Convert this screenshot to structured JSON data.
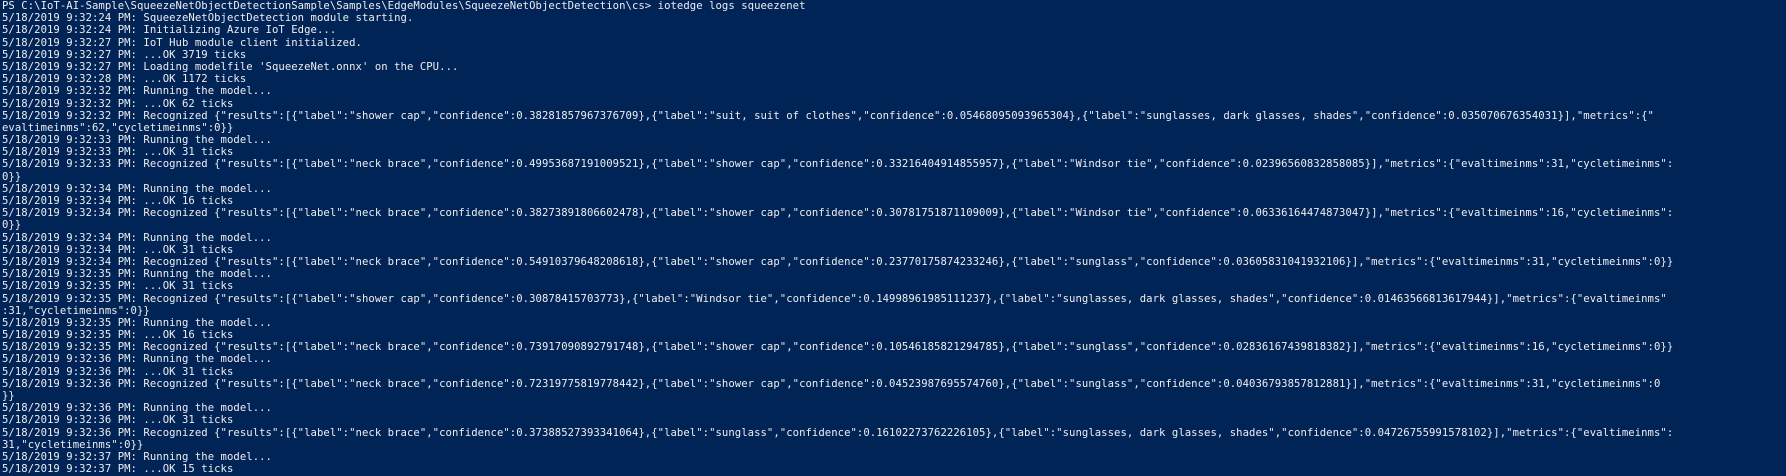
{
  "terminal": {
    "background": "#012456",
    "foreground": "#eeedf0",
    "lines": [
      "PS C:\\IoT-AI-Sample\\SqueezeNetObjectDetectionSample\\Samples\\EdgeModules\\SqueezeNetObjectDetection\\cs> iotedge logs squeezenet",
      "5/18/2019 9:32:24 PM: SqueezeNetObjectDetection module starting.",
      "5/18/2019 9:32:24 PM: Initializing Azure IoT Edge...",
      "5/18/2019 9:32:27 PM: IoT Hub module client initialized.",
      "5/18/2019 9:32:27 PM: ...OK 3719 ticks",
      "5/18/2019 9:32:27 PM: Loading modelfile 'SqueezeNet.onnx' on the CPU...",
      "5/18/2019 9:32:28 PM: ...OK 1172 ticks",
      "5/18/2019 9:32:32 PM: Running the model...",
      "5/18/2019 9:32:32 PM: ...OK 62 ticks",
      "5/18/2019 9:32:32 PM: Recognized {\"results\":[{\"label\":\"shower cap\",\"confidence\":0.38281857967376709},{\"label\":\"suit, suit of clothes\",\"confidence\":0.05468095093965304},{\"label\":\"sunglasses, dark glasses, shades\",\"confidence\":0.035070676354031}],\"metrics\":{\"",
      "evaltimeinms\":62,\"cycletimeinms\":0}}",
      "5/18/2019 9:32:33 PM: Running the model...",
      "5/18/2019 9:32:33 PM: ...OK 31 ticks",
      "5/18/2019 9:32:33 PM: Recognized {\"results\":[{\"label\":\"neck brace\",\"confidence\":0.49953687191009521},{\"label\":\"shower cap\",\"confidence\":0.33216404914855957},{\"label\":\"Windsor tie\",\"confidence\":0.02396560832858085}],\"metrics\":{\"evaltimeinms\":31,\"cycletimeinms\":",
      "0}}",
      "5/18/2019 9:32:34 PM: Running the model...",
      "5/18/2019 9:32:34 PM: ...OK 16 ticks",
      "5/18/2019 9:32:34 PM: Recognized {\"results\":[{\"label\":\"neck brace\",\"confidence\":0.38273891806602478},{\"label\":\"shower cap\",\"confidence\":0.30781751871109009},{\"label\":\"Windsor tie\",\"confidence\":0.06336164474873047}],\"metrics\":{\"evaltimeinms\":16,\"cycletimeinms\":",
      "0}}",
      "5/18/2019 9:32:34 PM: Running the model...",
      "5/18/2019 9:32:34 PM: ...OK 31 ticks",
      "5/18/2019 9:32:34 PM: Recognized {\"results\":[{\"label\":\"neck brace\",\"confidence\":0.54910379648208618},{\"label\":\"shower cap\",\"confidence\":0.23770175874233246},{\"label\":\"sunglass\",\"confidence\":0.03605831041932106}],\"metrics\":{\"evaltimeinms\":31,\"cycletimeinms\":0}}",
      "5/18/2019 9:32:35 PM: Running the model...",
      "5/18/2019 9:32:35 PM: ...OK 31 ticks",
      "5/18/2019 9:32:35 PM: Recognized {\"results\":[{\"label\":\"shower cap\",\"confidence\":0.30878415703773},{\"label\":\"Windsor tie\",\"confidence\":0.14998961985111237},{\"label\":\"sunglasses, dark glasses, shades\",\"confidence\":0.01463566813617944}],\"metrics\":{\"evaltimeinms\"",
      ":31,\"cycletimeinms\":0}}",
      "5/18/2019 9:32:35 PM: Running the model...",
      "5/18/2019 9:32:35 PM: ...OK 16 ticks",
      "5/18/2019 9:32:35 PM: Recognized {\"results\":[{\"label\":\"neck brace\",\"confidence\":0.73917090892791748},{\"label\":\"shower cap\",\"confidence\":0.10546185821294785},{\"label\":\"sunglass\",\"confidence\":0.02836167439818382}],\"metrics\":{\"evaltimeinms\":16,\"cycletimeinms\":0}}",
      "5/18/2019 9:32:36 PM: Running the model...",
      "5/18/2019 9:32:36 PM: ...OK 31 ticks",
      "5/18/2019 9:32:36 PM: Recognized {\"results\":[{\"label\":\"neck brace\",\"confidence\":0.72319775819778442},{\"label\":\"shower cap\",\"confidence\":0.04523987695574760},{\"label\":\"sunglass\",\"confidence\":0.04036793857812881}],\"metrics\":{\"evaltimeinms\":31,\"cycletimeinms\":0",
      "}}",
      "5/18/2019 9:32:36 PM: Running the model...",
      "5/18/2019 9:32:36 PM: ...OK 31 ticks",
      "5/18/2019 9:32:36 PM: Recognized {\"results\":[{\"label\":\"neck brace\",\"confidence\":0.37388527393341064},{\"label\":\"sunglass\",\"confidence\":0.16102273762226105},{\"label\":\"sunglasses, dark glasses, shades\",\"confidence\":0.04726755991578102}],\"metrics\":{\"evaltimeinms\":",
      "31,\"cycletimeinms\":0}}",
      "5/18/2019 9:32:37 PM: Running the model...",
      "5/18/2019 9:32:37 PM: ...OK 15 ticks"
    ]
  }
}
